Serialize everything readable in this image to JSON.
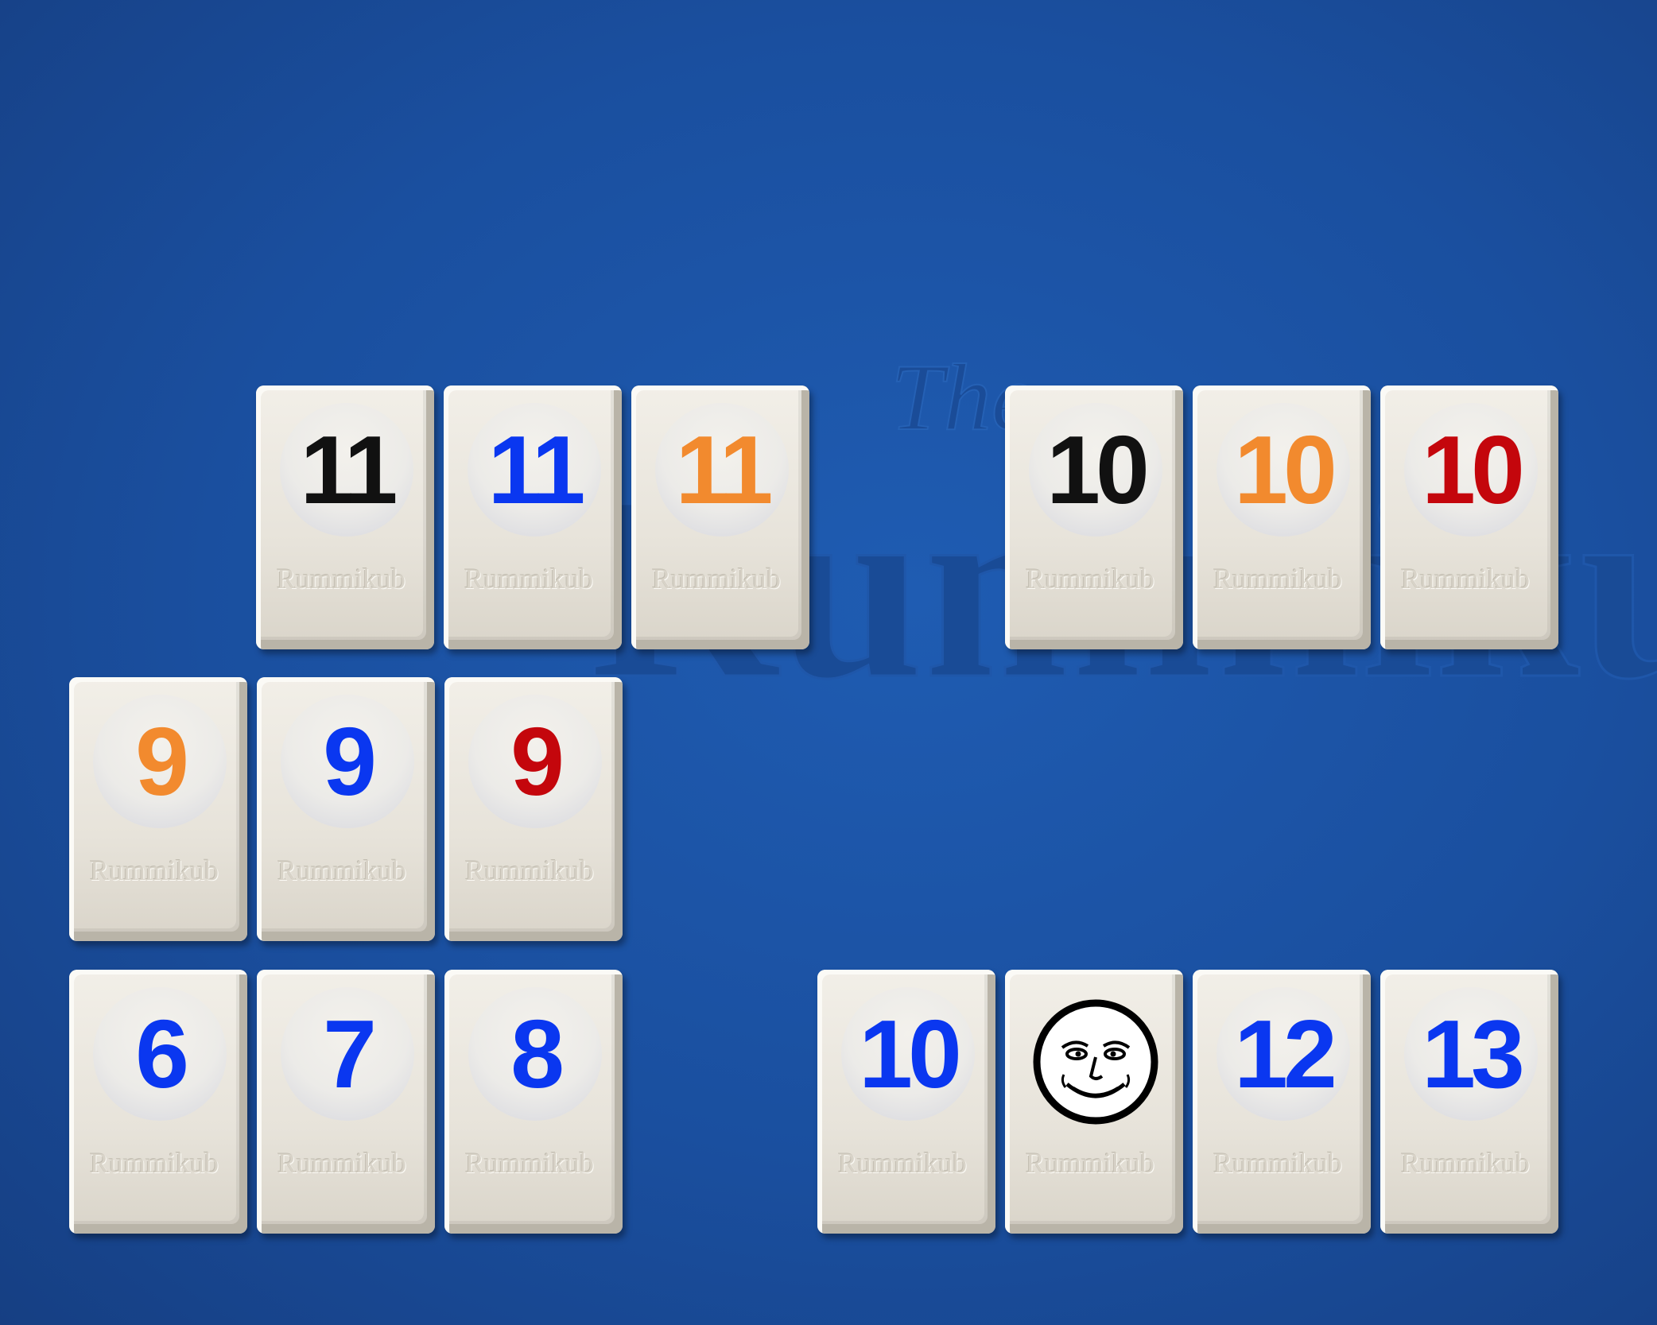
{
  "background_color": "#1a4f9f",
  "tile_brand": "Rummikub",
  "colors": {
    "black": "#111111",
    "blue": "#0a37f0",
    "orange": "#f28a2e",
    "red": "#c4060c"
  },
  "sets": [
    {
      "tiles": [
        {
          "number": "11",
          "color": "black"
        },
        {
          "number": "11",
          "color": "blue"
        },
        {
          "number": "11",
          "color": "orange"
        }
      ]
    },
    {
      "tiles": [
        {
          "number": "10",
          "color": "black"
        },
        {
          "number": "10",
          "color": "orange"
        },
        {
          "number": "10",
          "color": "red"
        }
      ]
    },
    {
      "tiles": [
        {
          "number": "9",
          "color": "orange"
        },
        {
          "number": "9",
          "color": "blue"
        },
        {
          "number": "9",
          "color": "red"
        }
      ]
    },
    {
      "tiles": [
        {
          "number": "6",
          "color": "blue"
        },
        {
          "number": "7",
          "color": "blue"
        },
        {
          "number": "8",
          "color": "blue"
        }
      ]
    },
    {
      "tiles": [
        {
          "number": "10",
          "color": "blue"
        },
        {
          "joker": true,
          "icon": "joker-face-icon"
        },
        {
          "number": "12",
          "color": "blue"
        },
        {
          "number": "13",
          "color": "blue"
        }
      ]
    }
  ]
}
